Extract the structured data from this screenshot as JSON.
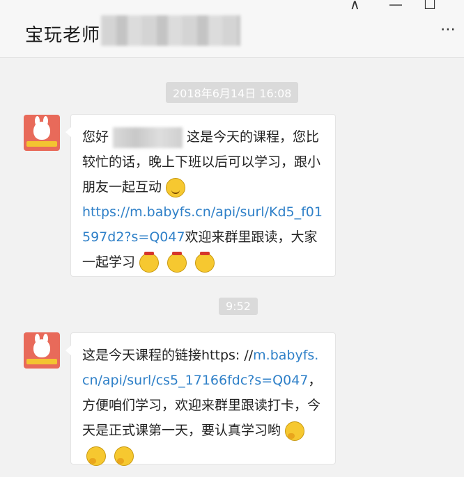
{
  "window": {
    "title": "宝玩老师",
    "controls": {
      "pin": "⊼",
      "minimize": "—",
      "maximize": "☐"
    },
    "more": "⋯"
  },
  "chat": {
    "timestamps": [
      "2018年6月14日 16:08",
      "9:52"
    ],
    "messages": [
      {
        "sender": "宝玩老师",
        "greeting": "您好",
        "text_a": "这是今天的课程，您比较忙的话，晚上下班以后可以学习，跟小朋友一起互动",
        "link": "https://m.babyfs.cn/api/surl/Kd5_f01597d2?s=Q047",
        "text_b": "欢迎来群里跟读，大家一起学习"
      },
      {
        "sender": "宝玩老师",
        "text_a": "这是今天课程的链接https: //",
        "link": "m.babyfs.cn/api/surl/cs5_17166fdc?s=Q047",
        "text_b": "，方便咱们学习，欢迎来群里跟读打卡，今天是正式课第一天，要认真学习哟"
      }
    ]
  },
  "colors": {
    "link": "#2f80c8",
    "background": "#f2f2f2",
    "bubble": "#ffffff"
  },
  "icons": [
    "pin-icon",
    "minimize-icon",
    "maximize-icon",
    "more-icon",
    "avatar",
    "smile-emoji",
    "angry-emoji",
    "thinking-emoji"
  ]
}
